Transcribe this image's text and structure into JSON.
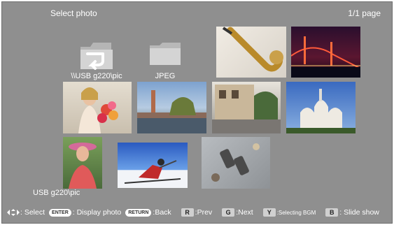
{
  "header": {
    "title": "Select photo",
    "page_indicator": "1/1 page"
  },
  "folders": [
    {
      "label": "\\\\USB g220\\pic",
      "icon": "back-folder-icon"
    },
    {
      "label": "JPEG",
      "icon": "folder-icon"
    }
  ],
  "photos": [
    {
      "subject": "saxophone"
    },
    {
      "subject": "bridge-night"
    },
    {
      "subject": "woman-flowers"
    },
    {
      "subject": "church-river"
    },
    {
      "subject": "street-cafe"
    },
    {
      "subject": "basilica"
    },
    {
      "subject": "woman-hat"
    },
    {
      "subject": "skier"
    },
    {
      "subject": "binoculars"
    }
  ],
  "current_path": "USB g220\\pic",
  "footer": {
    "select": ": Select",
    "enter_key": "ENTER",
    "display": ": Display photo",
    "return_key": "RETURN",
    "back": ":Back",
    "r_key": "R",
    "prev": ":Prev",
    "g_key": "G",
    "next": ":Next",
    "y_key": "Y",
    "bgm": ":Selecting BGM",
    "b_key": "B",
    "slideshow": ": Slide show"
  },
  "colors": {
    "background": "#8f8f8f",
    "text": "#ffffff"
  }
}
